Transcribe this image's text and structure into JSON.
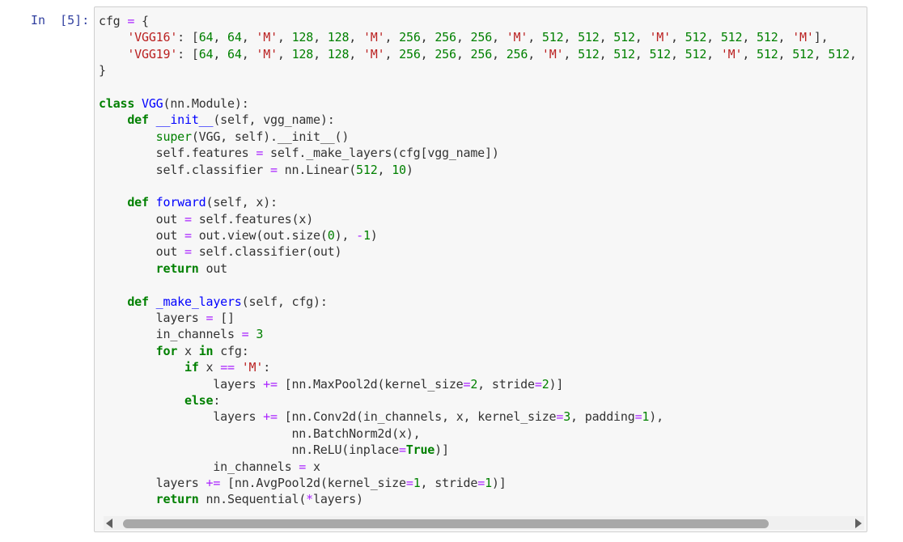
{
  "prompt": "In  [5]:",
  "code_lines": [
    "cfg = {",
    "    'VGG16': [64, 64, 'M', 128, 128, 'M', 256, 256, 256, 'M', 512, 512, 512, 'M', 512, 512, 512, 'M'],",
    "    'VGG19': [64, 64, 'M', 128, 128, 'M', 256, 256, 256, 256, 'M', 512, 512, 512, 512, 'M', 512, 512, 512,",
    "}",
    "",
    "class VGG(nn.Module):",
    "    def __init__(self, vgg_name):",
    "        super(VGG, self).__init__()",
    "        self.features = self._make_layers(cfg[vgg_name])",
    "        self.classifier = nn.Linear(512, 10)",
    "",
    "    def forward(self, x):",
    "        out = self.features(x)",
    "        out = out.view(out.size(0), -1)",
    "        out = self.classifier(out)",
    "        return out",
    "",
    "    def _make_layers(self, cfg):",
    "        layers = []",
    "        in_channels = 3",
    "        for x in cfg:",
    "            if x == 'M':",
    "                layers += [nn.MaxPool2d(kernel_size=2, stride=2)]",
    "            else:",
    "                layers += [nn.Conv2d(in_channels, x, kernel_size=3, padding=1),",
    "                           nn.BatchNorm2d(x),",
    "                           nn.ReLU(inplace=True)]",
    "                in_channels = x",
    "        layers += [nn.AvgPool2d(kernel_size=1, stride=1)]",
    "        return nn.Sequential(*layers)"
  ],
  "scrollbar": {
    "position_fraction": 0.0,
    "visible_fraction": 0.85
  },
  "colors": {
    "keyword": "#008000",
    "function_name": "#0000ff",
    "string": "#ba2121",
    "number": "#008000",
    "operator": "#aa22ff",
    "prompt": "#303f9f"
  }
}
